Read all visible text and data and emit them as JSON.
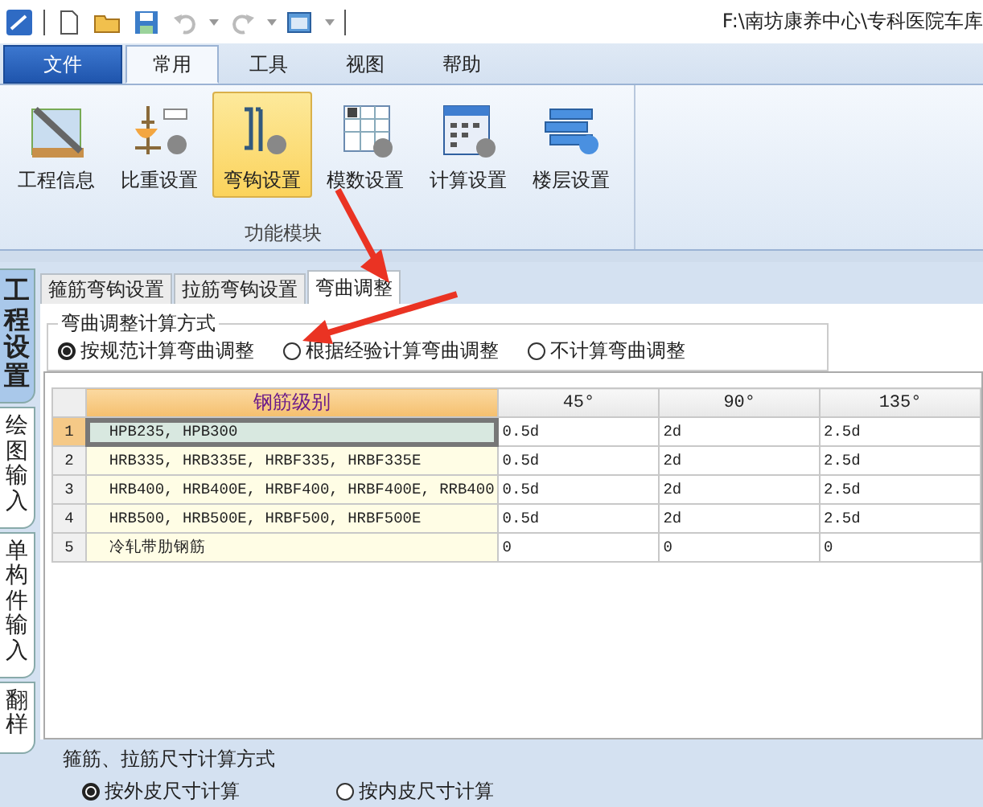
{
  "quick_access": {
    "title_path": "F:\\南坊康养中心\\专科医院车库"
  },
  "ribbon": {
    "tabs": [
      {
        "label": "文件",
        "kind": "file",
        "selected": false
      },
      {
        "label": "常用",
        "kind": "tab",
        "selected": true
      },
      {
        "label": "工具",
        "kind": "tab",
        "selected": false
      },
      {
        "label": "视图",
        "kind": "tab",
        "selected": false
      },
      {
        "label": "帮助",
        "kind": "tab",
        "selected": false
      }
    ],
    "group": {
      "label": "功能模块",
      "buttons": [
        {
          "label": "工程信息",
          "selected": false
        },
        {
          "label": "比重设置",
          "selected": false
        },
        {
          "label": "弯钩设置",
          "selected": true
        },
        {
          "label": "模数设置",
          "selected": false
        },
        {
          "label": "计算设置",
          "selected": false
        },
        {
          "label": "楼层设置",
          "selected": false
        }
      ]
    }
  },
  "side_tabs": [
    {
      "label": "工程设置",
      "selected": true
    },
    {
      "label": "绘图输入",
      "selected": false
    },
    {
      "label": "单构件输入",
      "selected": false
    },
    {
      "label": "翻样",
      "selected": false
    }
  ],
  "tabs": [
    {
      "label": "箍筋弯钩设置",
      "selected": false
    },
    {
      "label": "拉筋弯钩设置",
      "selected": false
    },
    {
      "label": "弯曲调整",
      "selected": true
    }
  ],
  "bend_method": {
    "title": "弯曲调整计算方式",
    "options": [
      {
        "label": "按规范计算弯曲调整",
        "selected": true
      },
      {
        "label": "根据经验计算弯曲调整",
        "selected": false
      },
      {
        "label": "不计算弯曲调整",
        "selected": false
      }
    ]
  },
  "table": {
    "columns": [
      "钢筋级别",
      "45°",
      "90°",
      "135°"
    ],
    "rows": [
      {
        "index": "1",
        "selected": true,
        "cells": [
          "HPB235, HPB300",
          "0.5d",
          "2d",
          "2.5d"
        ]
      },
      {
        "index": "2",
        "selected": false,
        "cells": [
          "HRB335, HRB335E, HRBF335, HRBF335E",
          "0.5d",
          "2d",
          "2.5d"
        ]
      },
      {
        "index": "3",
        "selected": false,
        "cells": [
          "HRB400, HRB400E, HRBF400, HRBF400E, RRB400",
          "0.5d",
          "2d",
          "2.5d"
        ]
      },
      {
        "index": "4",
        "selected": false,
        "cells": [
          "HRB500, HRB500E, HRBF500, HRBF500E",
          "0.5d",
          "2d",
          "2.5d"
        ]
      },
      {
        "index": "5",
        "selected": false,
        "cells": [
          "冷轧带肋钢筋",
          "0",
          "0",
          "0"
        ]
      }
    ]
  },
  "size_method": {
    "title": "箍筋、拉筋尺寸计算方式",
    "options": [
      {
        "label": "按外皮尺寸计算",
        "selected": true
      },
      {
        "label": "按内皮尺寸计算",
        "selected": false
      }
    ]
  }
}
